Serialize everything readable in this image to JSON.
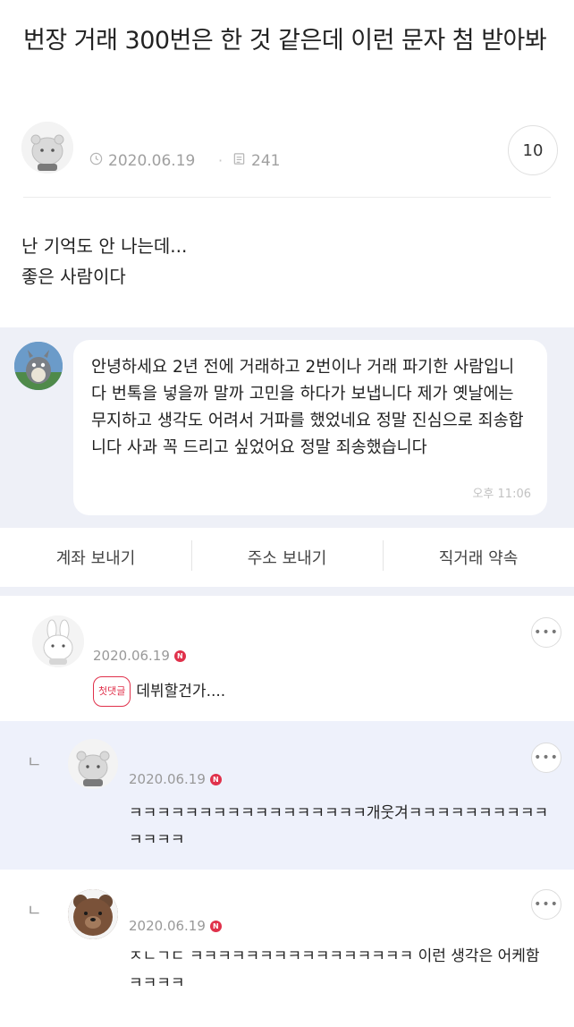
{
  "post": {
    "title": "번장 거래 300번은 한 것 같은데 이런 문자 첨 받아봐",
    "date": "2020.06.19",
    "views": "241",
    "comment_count": "10",
    "body_line1": "난 기억도 안 나는데...",
    "body_line2": "좋은 사람이다"
  },
  "chat": {
    "message": "안녕하세요 2년 전에 거래하고 2번이나 거래 파기한 사람입니다 번톡을 넣을까 말까 고민을 하다가 보냅니다 제가 옛날에는 무지하고 생각도 어려서 거파를 했었네요 정말 진심으로 죄송합니다 사과 꼭 드리고 싶었어요 정말 죄송했습니다",
    "time": "오후 11:06",
    "actions": [
      "계좌 보내기",
      "주소 보내기",
      "직거래 약속"
    ]
  },
  "comments": [
    {
      "date": "2020.06.19",
      "new_badge": "N",
      "tag": "첫댓글",
      "text": "데뷔할건가...."
    },
    {
      "reply_mark": "ㄴ",
      "date": "2020.06.19",
      "new_badge": "N",
      "text": "ㅋㅋㅋㅋㅋㅋㅋㅋㅋㅋㅋㅋㅋㅋㅋㅋㅋ개웃겨ㅋㅋㅋㅋㅋㅋㅋㅋㅋㅋㅋㅋㅋㅋ"
    },
    {
      "reply_mark": "ㄴ",
      "date": "2020.06.19",
      "new_badge": "N",
      "text": "ㅈㄴㄱㄷ ㅋㅋㅋㅋㅋㅋㅋㅋㅋㅋㅋㅋㅋㅋㅋㅋ 이런 생각은 어케함 ㅋㅋㅋㅋ"
    }
  ],
  "more_label": "•••",
  "icons": {
    "clock": "clock-icon",
    "views": "document-icon",
    "more": "more-icon"
  },
  "colors": {
    "badge": "#e0314b",
    "chat_bg": "#eef0f7",
    "reply_bg": "#eef1fb"
  }
}
